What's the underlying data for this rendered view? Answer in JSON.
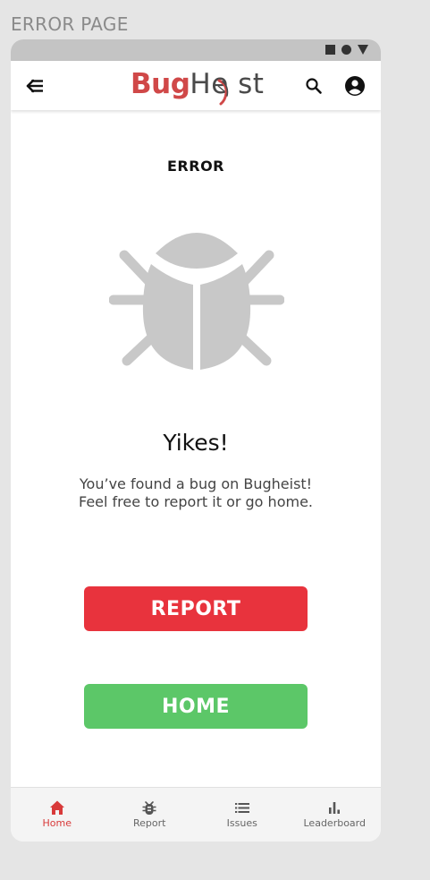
{
  "page_label": "ERROR PAGE",
  "header": {
    "logo_bug": "Bug",
    "logo_heist": "He st"
  },
  "main": {
    "title": "ERROR",
    "heading": "Yikes!",
    "message_line1": "You’ve found a bug on Bugheist!",
    "message_line2": "Feel free to report it or go home.",
    "report_label": "REPORT",
    "home_label": "HOME"
  },
  "bottom_nav": {
    "items": [
      {
        "label": "Home",
        "icon": "home-icon",
        "active": true
      },
      {
        "label": "Report",
        "icon": "bug-icon",
        "active": false
      },
      {
        "label": "Issues",
        "icon": "list-icon",
        "active": false
      },
      {
        "label": "Leaderboard",
        "icon": "bar-chart-icon",
        "active": false
      }
    ]
  },
  "colors": {
    "brand_red": "#d04848",
    "report_button": "#e8333d",
    "home_button": "#5cc768",
    "illustration": "#c8c8c8",
    "status_bar": "#c4c4c4",
    "active_nav": "#d83a3a"
  }
}
